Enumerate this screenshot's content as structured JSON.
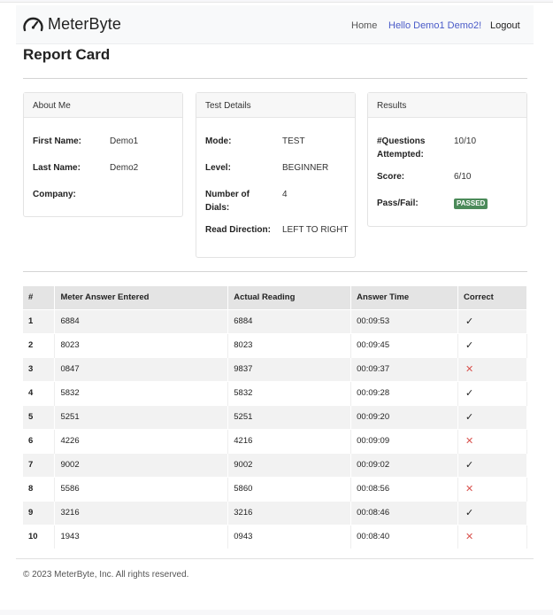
{
  "navbar": {
    "brand": "MeterByte",
    "home": "Home",
    "hello": "Hello Demo1 Demo2!",
    "logout": "Logout"
  },
  "page_title": "Report Card",
  "about": {
    "title": "About Me",
    "first_name_label": "First Name:",
    "first_name": "Demo1",
    "last_name_label": "Last Name:",
    "last_name": "Demo2",
    "company_label": "Company:"
  },
  "test_details": {
    "title": "Test Details",
    "mode_label": "Mode:",
    "mode": "TEST",
    "level_label": "Level:",
    "level": "BEGINNER",
    "dials_label_1": "Number of",
    "dials_label_2": "Dials:",
    "dials": "4",
    "direction_label": "Read Direction:",
    "direction": "LEFT TO RIGHT"
  },
  "results": {
    "title": "Results",
    "attempted_label_1": "#Questions",
    "attempted_label_2": "Attempted:",
    "attempted": "10/10",
    "score_label": "Score:",
    "score": "6/10",
    "passfail_label": "Pass/Fail:",
    "passfail": "PASSED",
    "passfail_color": "#4b8a59"
  },
  "table": {
    "headers": [
      "#",
      "Meter Answer Entered",
      "Actual Reading",
      "Answer Time",
      "Correct"
    ],
    "rows": [
      {
        "n": "1",
        "entered": "6884",
        "actual": "6884",
        "time": "00:09:53",
        "correct": true
      },
      {
        "n": "2",
        "entered": "8023",
        "actual": "8023",
        "time": "00:09:45",
        "correct": true
      },
      {
        "n": "3",
        "entered": "0847",
        "actual": "9837",
        "time": "00:09:37",
        "correct": false
      },
      {
        "n": "4",
        "entered": "5832",
        "actual": "5832",
        "time": "00:09:28",
        "correct": true
      },
      {
        "n": "5",
        "entered": "5251",
        "actual": "5251",
        "time": "00:09:20",
        "correct": true
      },
      {
        "n": "6",
        "entered": "4226",
        "actual": "4216",
        "time": "00:09:09",
        "correct": false
      },
      {
        "n": "7",
        "entered": "9002",
        "actual": "9002",
        "time": "00:09:02",
        "correct": true
      },
      {
        "n": "8",
        "entered": "5586",
        "actual": "5860",
        "time": "00:08:56",
        "correct": false
      },
      {
        "n": "9",
        "entered": "3216",
        "actual": "3216",
        "time": "00:08:46",
        "correct": true
      },
      {
        "n": "10",
        "entered": "1943",
        "actual": "0943",
        "time": "00:08:40",
        "correct": false
      }
    ],
    "check_glyph": "✓",
    "cross_glyph": "✕",
    "cross_color": "#d9534f"
  },
  "footer": "© 2023 MeterByte, Inc. All rights reserved."
}
